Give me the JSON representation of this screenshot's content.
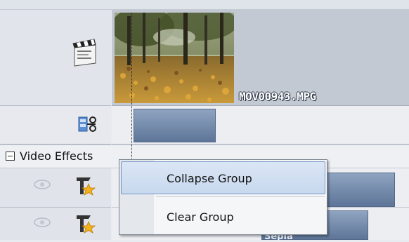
{
  "clip": {
    "filename": "MOV00943.MPG"
  },
  "effects_group": {
    "label": "Video Effects"
  },
  "context_menu": {
    "items": [
      {
        "label": "Collapse Group",
        "highlighted": true
      },
      {
        "label": "Clear Group",
        "highlighted": false
      }
    ]
  },
  "timeline": {
    "bar3_label": "Sepia"
  },
  "icons": {
    "clapboard": "clapboard-icon",
    "split_clip": "scissors-film-icon",
    "eye": "eye-icon",
    "fx": "video-effect-icon",
    "collapse": "minus-box-icon"
  },
  "colors": {
    "clip_bar": "#6b82a5",
    "menu_highlight": "#c7d8ee",
    "menu_border": "#7d8593"
  }
}
